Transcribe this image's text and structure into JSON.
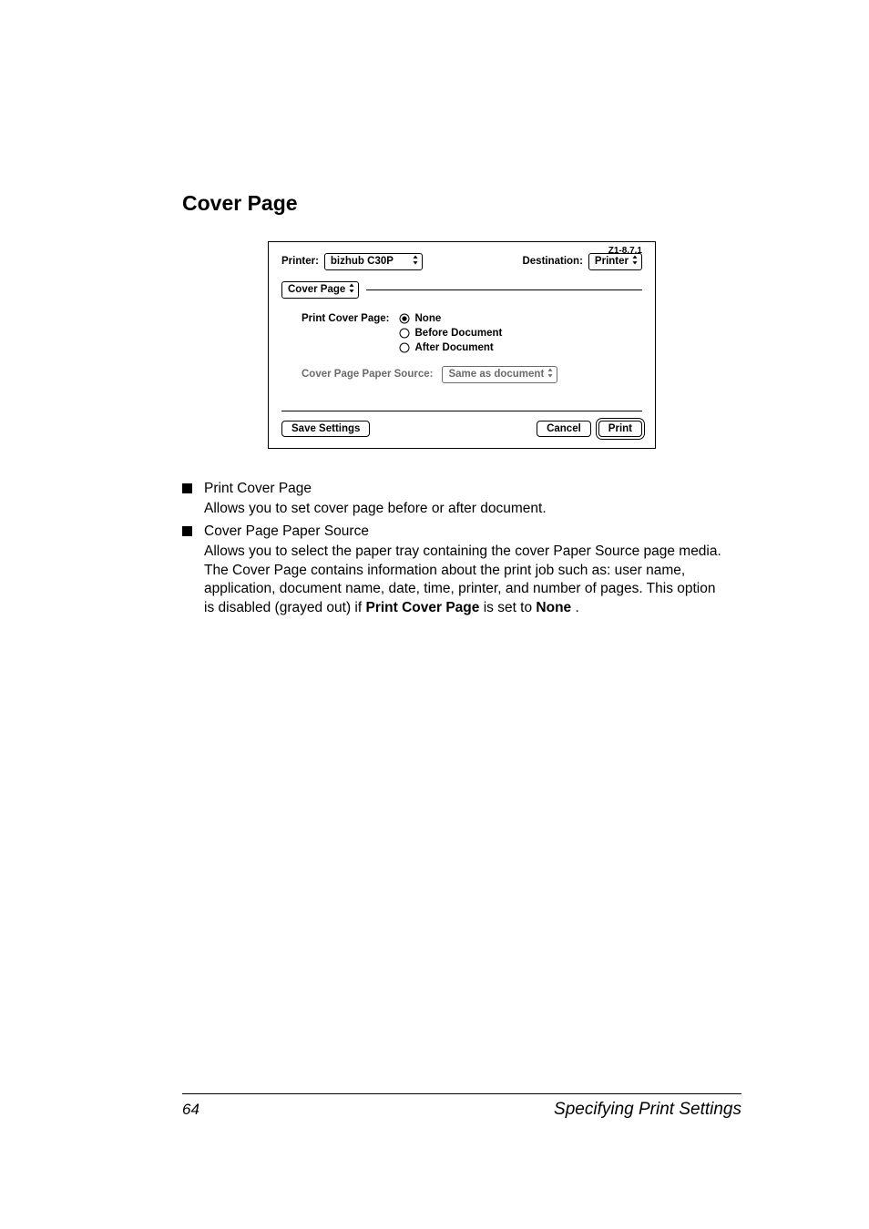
{
  "section_title": "Cover Page",
  "dialog": {
    "version": "Z1-8.7.1",
    "printer_label": "Printer:",
    "printer_value": "bizhub C30P",
    "destination_label": "Destination:",
    "destination_value": "Printer",
    "panel_value": "Cover Page",
    "print_cover_label": "Print Cover Page:",
    "radio_none": "None",
    "radio_before": "Before Document",
    "radio_after": "After Document",
    "paper_source_label": "Cover Page Paper Source:",
    "paper_source_value": "Same as document",
    "save_label": "Save Settings",
    "cancel_label": "Cancel",
    "print_label": "Print"
  },
  "bullets": {
    "item1_title": "Print Cover Page",
    "item1_body": "Allows you to set cover page before or after document.",
    "item2_title": "Cover Page Paper Source",
    "item2_body_a": "Allows you to select the paper tray containing the cover Paper Source page media. The Cover Page contains information about the print job such as: user name, application, document name, date, time, printer, and number of pages. This option is disabled (grayed out) if ",
    "item2_strong1": "Print Cover Page",
    "item2_body_b": " is set to ",
    "item2_strong2": "None",
    "item2_body_c": "."
  },
  "footer": {
    "page_number": "64",
    "title": "Specifying Print Settings"
  }
}
